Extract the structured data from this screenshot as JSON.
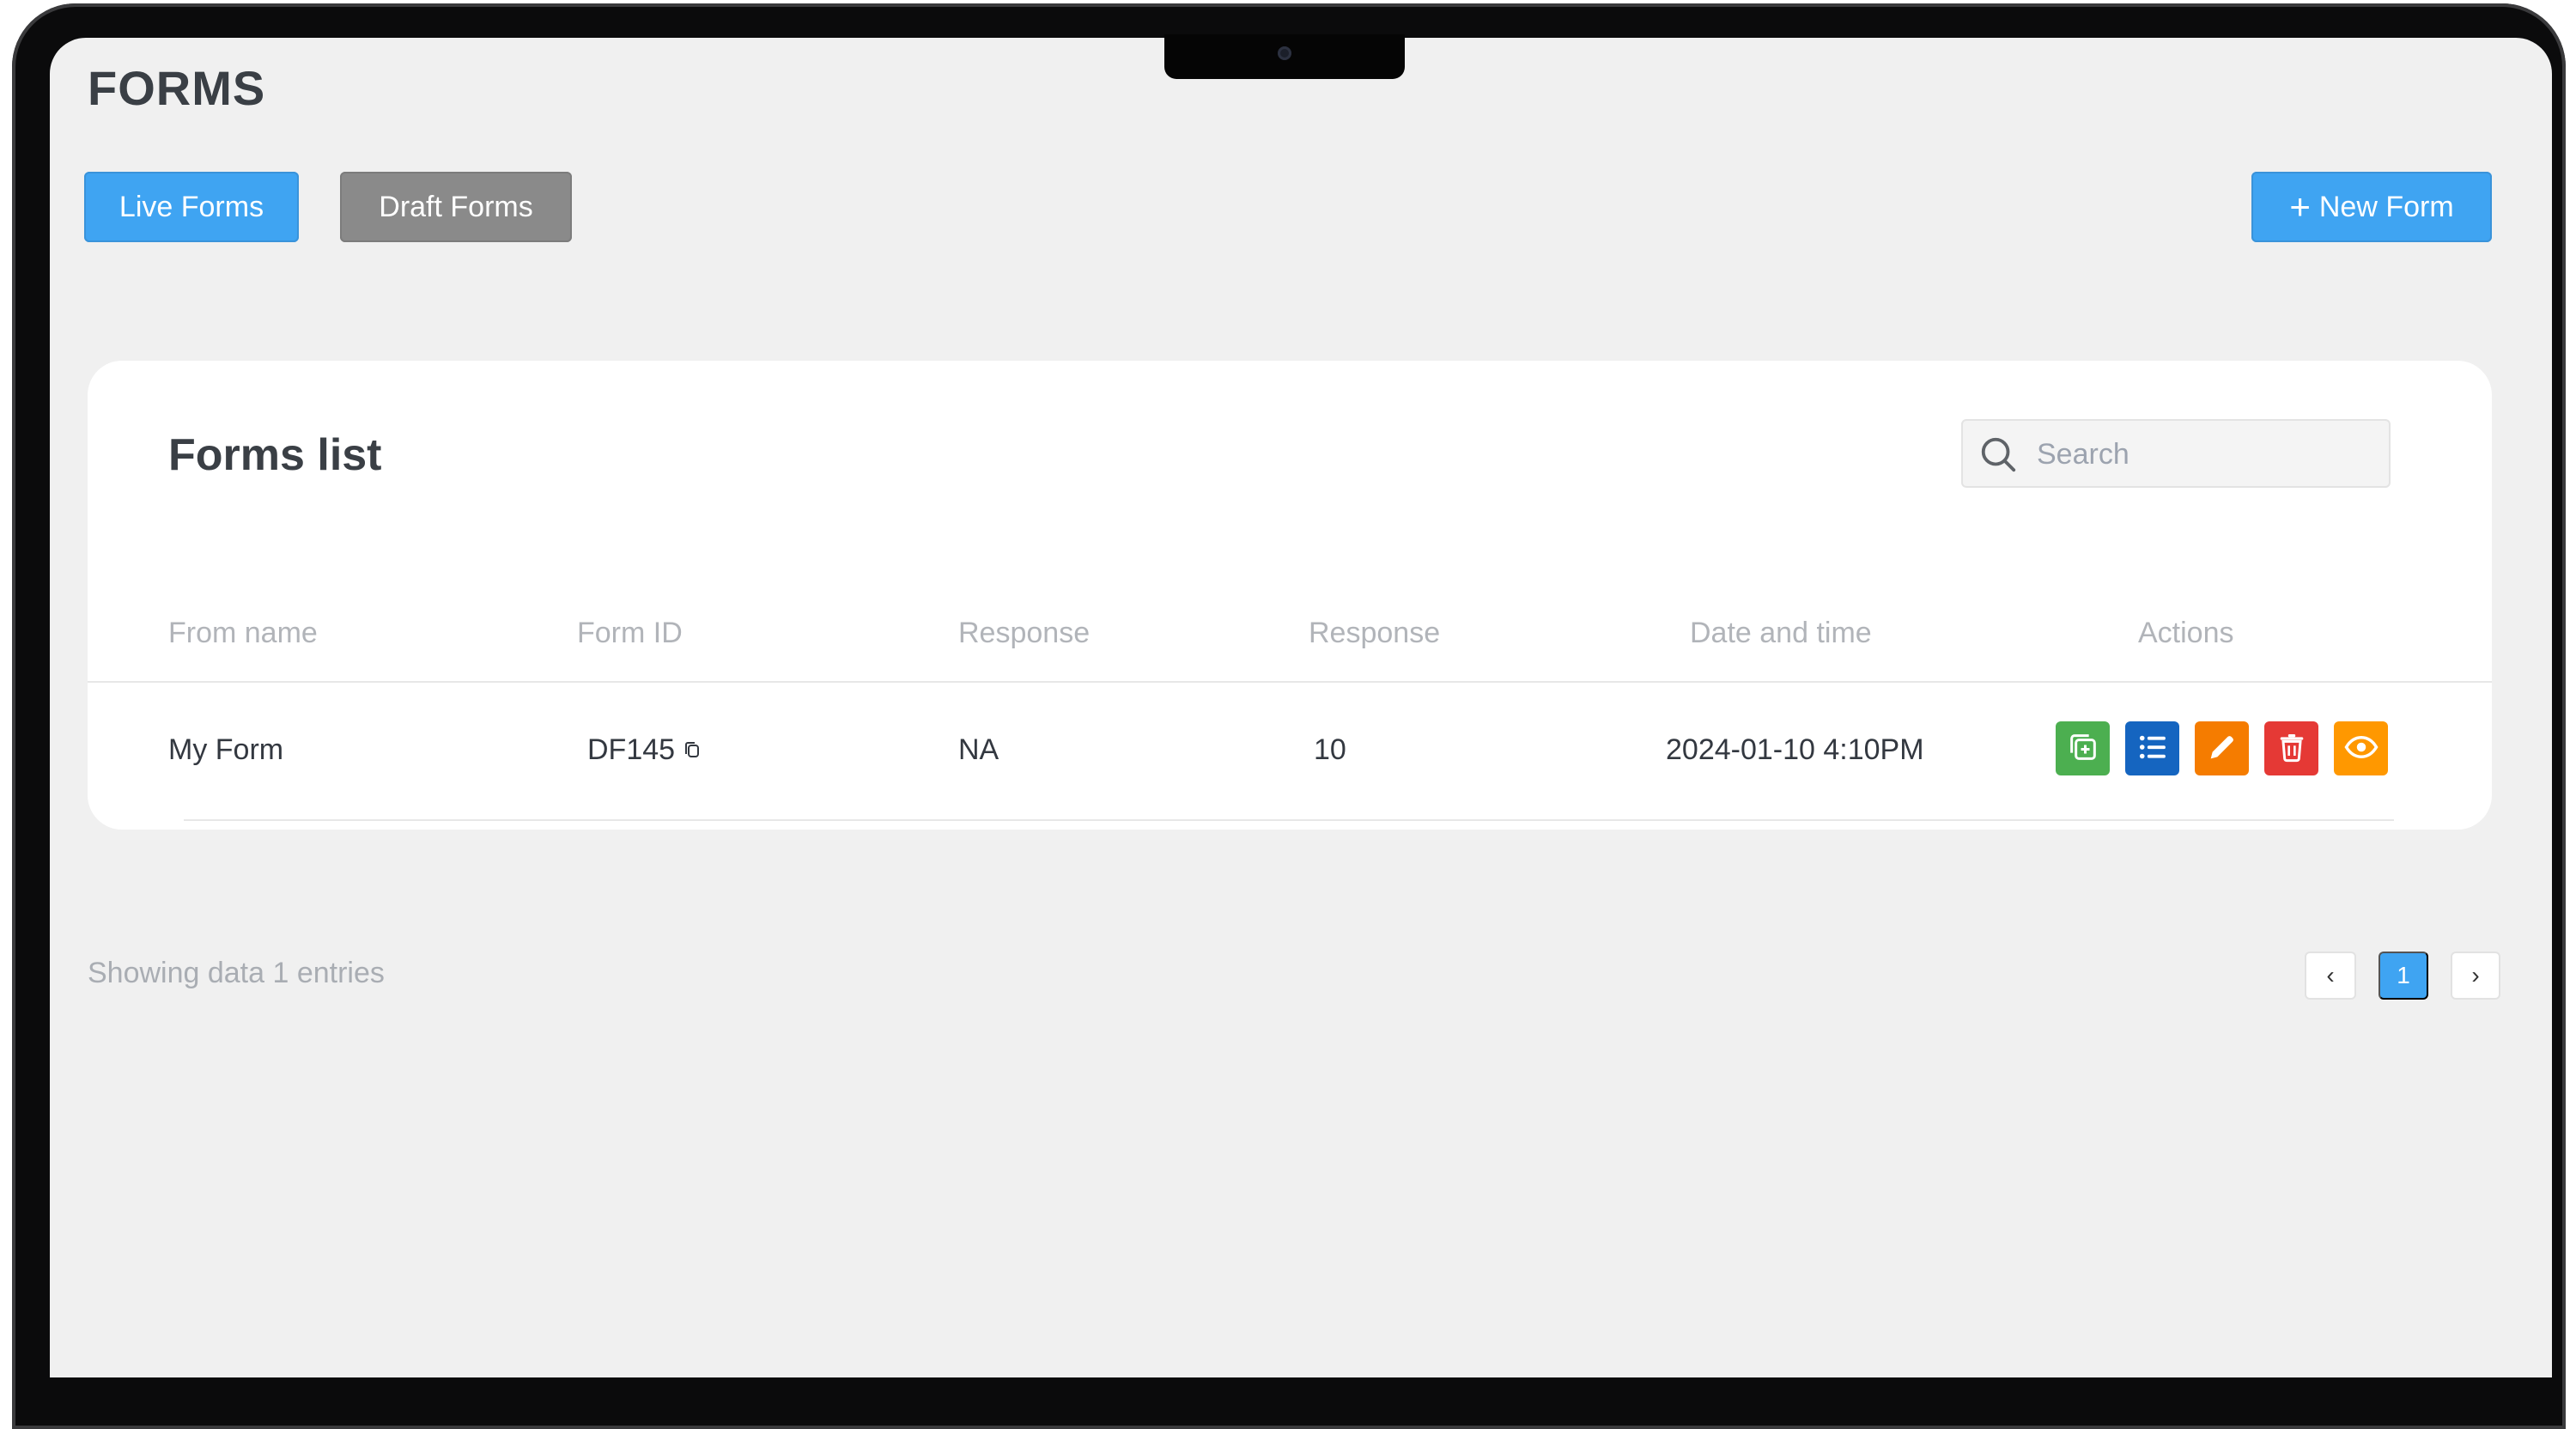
{
  "header": {
    "title": "FORMS"
  },
  "toolbar": {
    "live_forms_label": "Live Forms",
    "draft_forms_label": "Draft Forms",
    "new_form_label": "New Form"
  },
  "forms_list": {
    "title": "Forms list",
    "search": {
      "placeholder": "Search",
      "value": ""
    },
    "columns": [
      "From name",
      "Form ID",
      "Response",
      "Response",
      "Date and time",
      "Actions"
    ],
    "rows": [
      {
        "name": "My Form",
        "form_id": "DF145",
        "response_1": "NA",
        "response_2": "10",
        "datetime": "2024-01-10 4:10PM"
      }
    ],
    "action_icons": [
      "duplicate-icon",
      "list-icon",
      "edit-icon",
      "delete-icon",
      "view-icon"
    ]
  },
  "footer": {
    "showing_text": "Showing data 1 entries",
    "pagination": {
      "prev": "‹",
      "current": "1",
      "next": "›"
    }
  },
  "colors": {
    "primary": "#3fa4f2",
    "draft": "#8a8a8a",
    "duplicate": "#4caf50",
    "list": "#1565c0",
    "edit": "#f57c00",
    "delete": "#e53935",
    "view": "#ff9800"
  }
}
